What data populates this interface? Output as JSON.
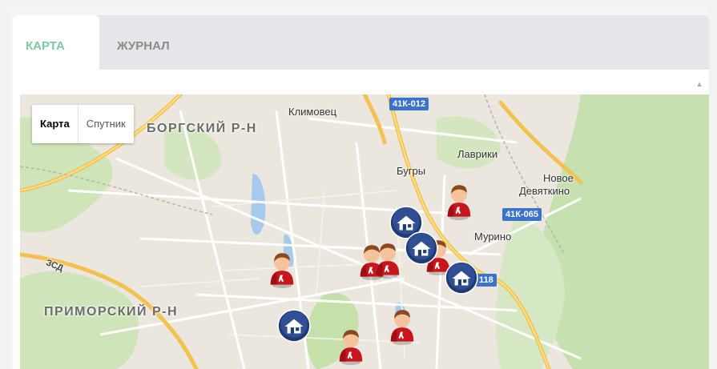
{
  "tabs": [
    {
      "label": "КАРТА",
      "active": true
    },
    {
      "label": "ЖУРНАЛ",
      "active": false
    }
  ],
  "map_type": {
    "options": [
      "Карта",
      "Спутник"
    ],
    "selected": "Карта"
  },
  "map_labels": {
    "districts": [
      "БОРГСКИЙ Р-Н",
      "ПРИМОРСКИЙ Р-Н"
    ],
    "places": [
      "Климовец",
      "Лаврики",
      "Бугры",
      "Новое",
      "Девяткино",
      "Мурино"
    ],
    "road_shields": [
      "41К-012",
      "41К-065",
      "118"
    ],
    "road_names": [
      "ЗСД"
    ]
  },
  "markers": {
    "person_count": 8,
    "building_count": 4
  },
  "colors": {
    "active_tab": "#7cc9a4",
    "inactive_tab": "#8a8a8a",
    "tabbar_bg": "#e4e6e9",
    "person_marker": "#c8161d",
    "building_marker": "#1f3a74",
    "road_shield": "#3a73c9",
    "highway": "#f3c150"
  }
}
